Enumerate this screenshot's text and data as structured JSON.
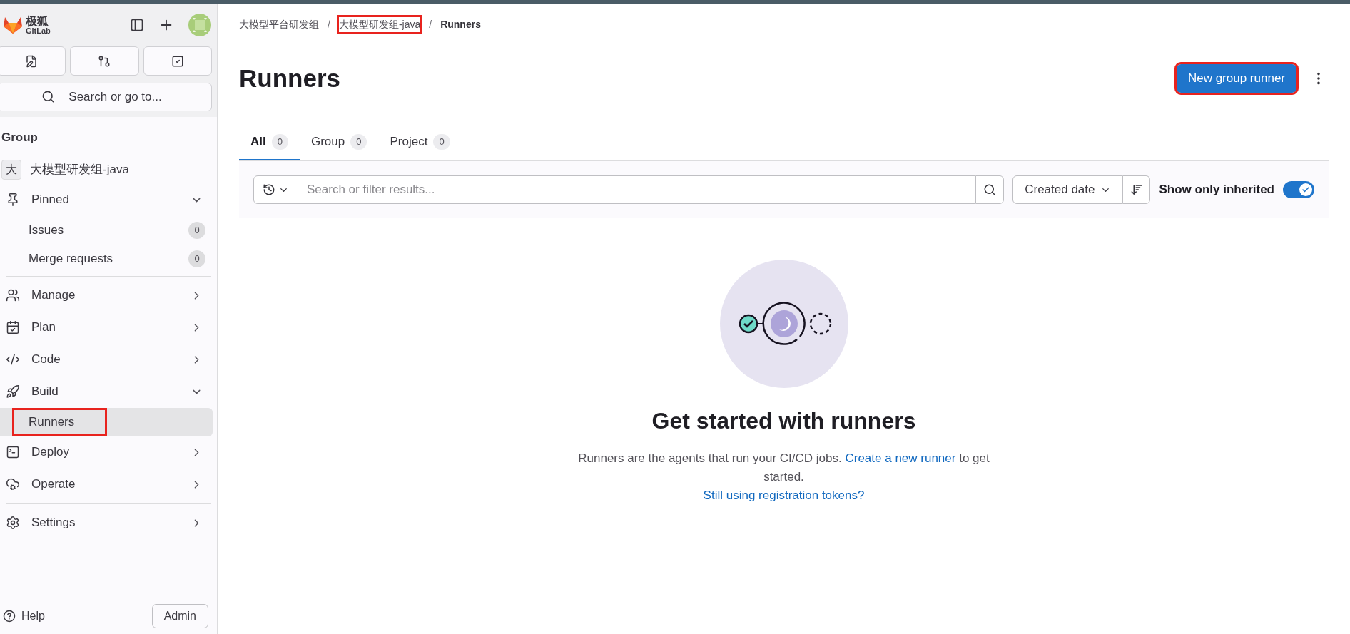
{
  "brand": {
    "name": "极狐",
    "sub": "GitLab"
  },
  "sidebar": {
    "search": {
      "placeholder": "Search or go to..."
    },
    "context_label": "Group",
    "group": {
      "avatar": "大",
      "name": "大模型研发组-java"
    },
    "sections": [
      {
        "label": "Pinned",
        "expanded": true,
        "divider_before": false,
        "children": [
          {
            "label": "Issues",
            "count": "0",
            "selected": false,
            "highlighted": false
          },
          {
            "label": "Merge requests",
            "count": "0",
            "selected": false,
            "highlighted": false
          }
        ]
      },
      {
        "label": "Manage",
        "expanded": false,
        "divider_before": true
      },
      {
        "label": "Plan",
        "expanded": false,
        "divider_before": false
      },
      {
        "label": "Code",
        "expanded": false,
        "divider_before": false
      },
      {
        "label": "Build",
        "expanded": true,
        "divider_before": false,
        "children": [
          {
            "label": "Runners",
            "selected": true,
            "highlighted": true
          }
        ]
      },
      {
        "label": "Deploy",
        "expanded": false,
        "divider_before": false
      },
      {
        "label": "Operate",
        "expanded": false,
        "divider_before": false
      },
      {
        "label": "Settings",
        "expanded": false,
        "divider_before": true
      }
    ],
    "footer": {
      "help": "Help",
      "admin": "Admin"
    }
  },
  "breadcrumbs": [
    {
      "label": "大模型平台研发组",
      "current": false,
      "highlighted": false
    },
    {
      "separator": "/",
      "label": "大模型研发组-java",
      "current": false,
      "highlighted": true
    },
    {
      "separator": "/",
      "label": "Runners",
      "current": true,
      "highlighted": false
    }
  ],
  "page": {
    "title": "Runners",
    "primary_button": {
      "label": "New group runner",
      "highlighted": true
    }
  },
  "tabs": [
    {
      "label": "All",
      "count": "0",
      "selected": true
    },
    {
      "label": "Group",
      "count": "0",
      "selected": false
    },
    {
      "label": "Project",
      "count": "0",
      "selected": false
    }
  ],
  "filter": {
    "placeholder": "Search or filter results...",
    "sort": "Created date",
    "toggle": {
      "label": "Show only inherited",
      "on": true
    }
  },
  "empty_state": {
    "title": "Get started with runners",
    "text": "Runners are the agents that run your CI/CD jobs.",
    "link": "Create a new runner",
    "text_after": "to get started.",
    "secondary_link": "Still using registration tokens?"
  }
}
